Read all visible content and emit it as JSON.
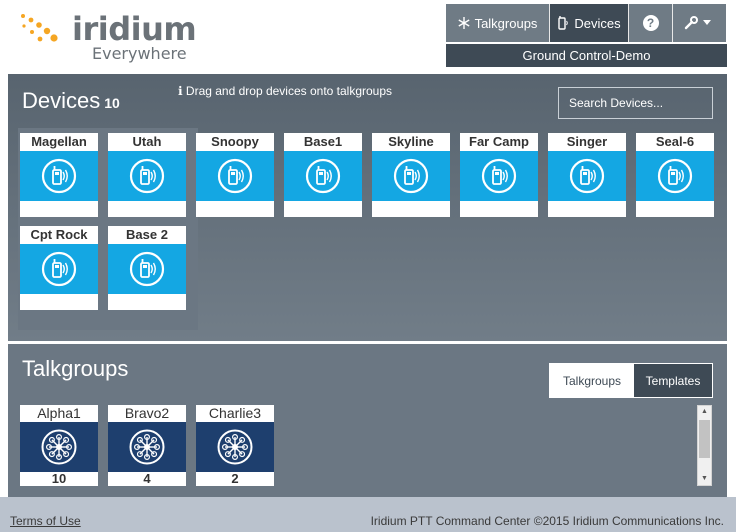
{
  "brand": {
    "name": "iridium",
    "tagline": "Everywhere",
    "dot_color": "#f5a623",
    "text_color": "#6b7278"
  },
  "nav": {
    "talkgroups_label": "Talkgroups",
    "devices_label": "Devices",
    "help_label": "?",
    "active": "Devices",
    "org_name": "Ground Control-Demo"
  },
  "devices": {
    "title": "Devices",
    "count": "10",
    "hint": "Drag and drop devices onto talkgroups",
    "search_placeholder": "Search Devices...",
    "items": [
      {
        "name": "Magellan"
      },
      {
        "name": "Utah"
      },
      {
        "name": "Snoopy"
      },
      {
        "name": "Base1"
      },
      {
        "name": "Skyline"
      },
      {
        "name": "Far Camp"
      },
      {
        "name": "Singer"
      },
      {
        "name": "Seal-6"
      },
      {
        "name": "Cpt Rock"
      },
      {
        "name": "Base 2"
      }
    ]
  },
  "talkgroups": {
    "title": "Talkgroups",
    "tabs": [
      {
        "label": "Talkgroups",
        "active": true
      },
      {
        "label": "Templates",
        "active": false
      }
    ],
    "items": [
      {
        "name": "Alpha1",
        "count": "10"
      },
      {
        "name": "Bravo2",
        "count": "4"
      },
      {
        "name": "Charlie3",
        "count": "2"
      }
    ]
  },
  "footer": {
    "terms_label": "Terms of Use",
    "copyright": "Iridium PTT Command Center ©2015 Iridium Communications Inc."
  },
  "colors": {
    "device_tile_blue": "#14a7e3",
    "talkgroup_tile_navy": "#1e3f6e",
    "nav_active": "#3e4a55",
    "nav_inactive": "#6f7b85"
  }
}
